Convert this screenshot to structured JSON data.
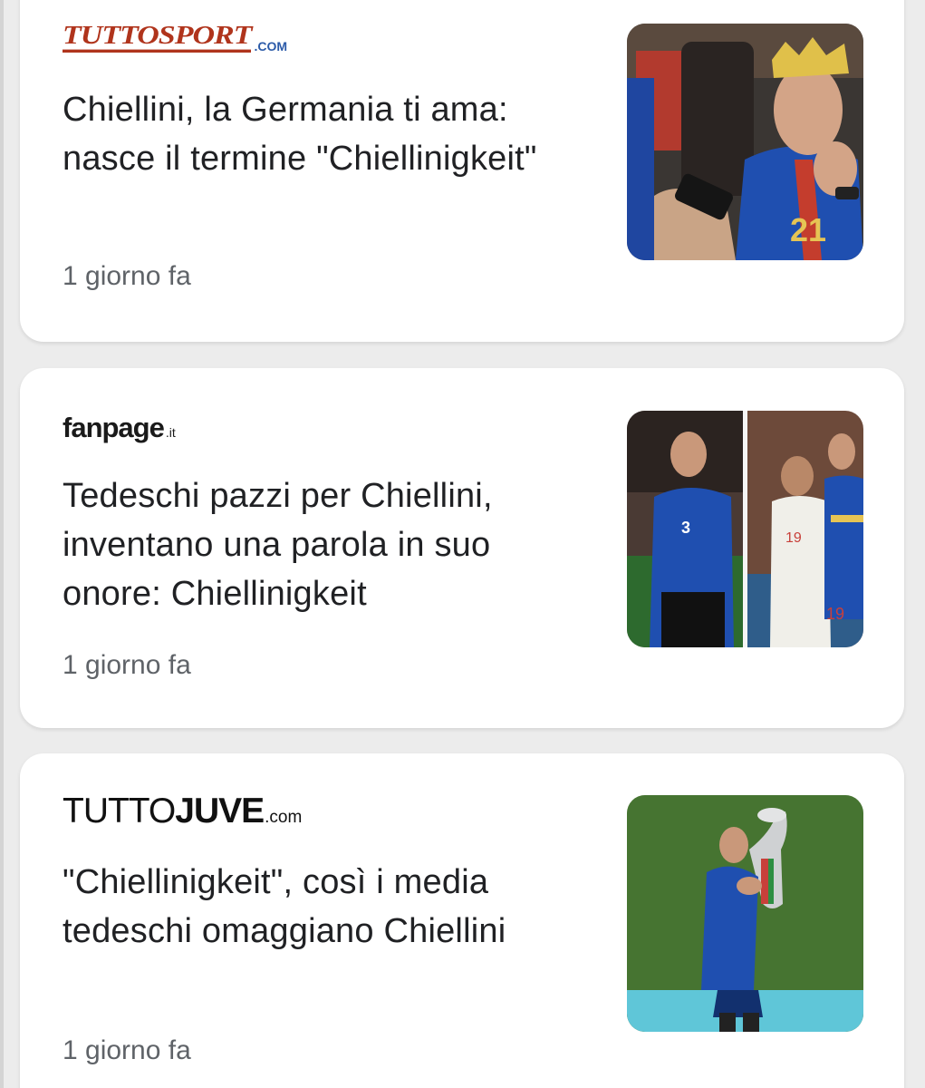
{
  "feed": {
    "articles": [
      {
        "source": {
          "main": "TUTTOSPORT",
          "tld": ".COM"
        },
        "headline": "Chiellini, la Germania ti ama: nasce il termine \"Chiellinigkeit\"",
        "timestamp": "1 giorno fa",
        "thumbnail": "photo-player-with-crown"
      },
      {
        "source": {
          "main": "fanpage",
          "tld": ".it"
        },
        "headline": "Tedeschi pazzi per Chiellini, inventano una parola in suo onore: Chiellinigkeit",
        "timestamp": "1 giorno fa",
        "thumbnail": "photo-two-players-split"
      },
      {
        "source": {
          "main_light": "TUTTO",
          "main_bold": "JUVE",
          "tld": ".com"
        },
        "headline": "\"Chiellinigkeit\", così i media tedeschi omaggiano Chiellini",
        "timestamp": "1 giorno fa",
        "thumbnail": "photo-player-with-trophy"
      }
    ]
  },
  "colors": {
    "background": "#ececec",
    "card": "#ffffff",
    "headline": "#202124",
    "timestamp": "#5f6368",
    "tuttosport_red": "#b0341c",
    "tuttosport_blue": "#2b5aa8"
  }
}
